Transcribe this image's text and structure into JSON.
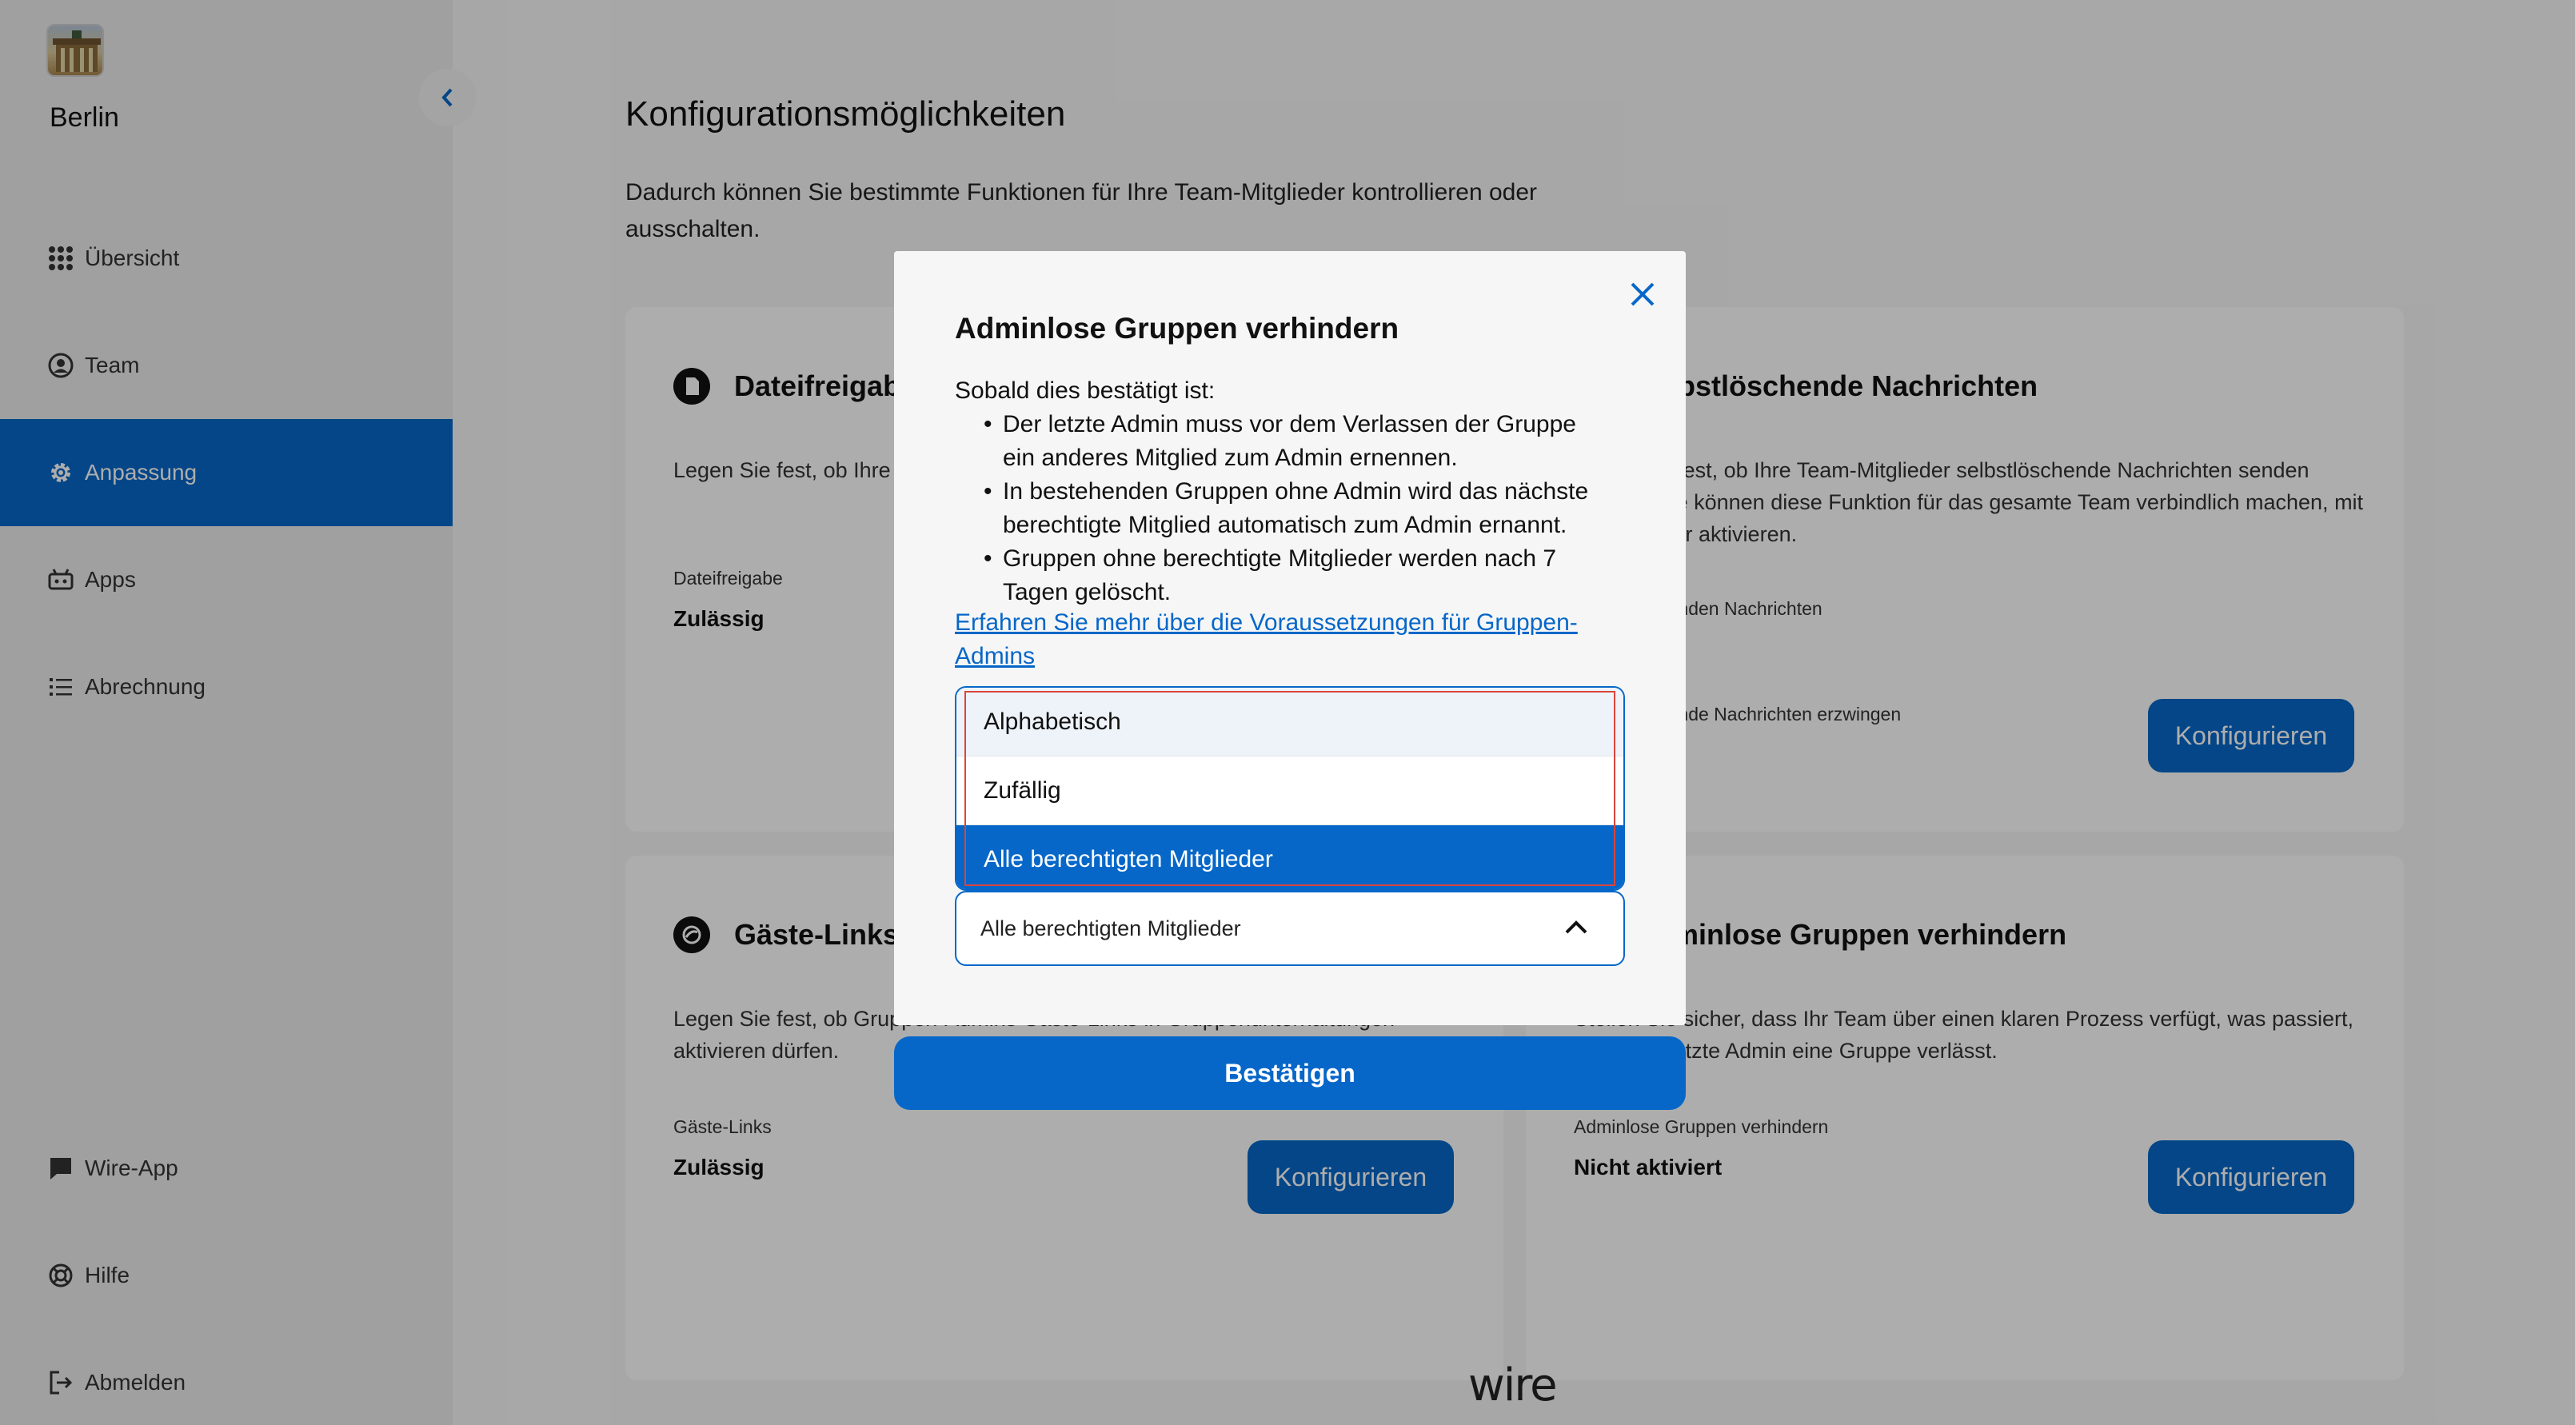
{
  "sidebar": {
    "team_name": "Berlin",
    "items": [
      {
        "label": "Übersicht",
        "icon": "grid-icon"
      },
      {
        "label": "Team",
        "icon": "user-circle-icon"
      },
      {
        "label": "Anpassung",
        "icon": "gear-icon",
        "active": true
      },
      {
        "label": "Apps",
        "icon": "apps-icon"
      },
      {
        "label": "Abrechnung",
        "icon": "list-icon"
      }
    ],
    "bottom_items": [
      {
        "label": "Wire-App",
        "icon": "chat-icon"
      },
      {
        "label": "Hilfe",
        "icon": "lifebuoy-icon"
      },
      {
        "label": "Abmelden",
        "icon": "logout-icon"
      }
    ]
  },
  "main": {
    "title": "Konfigurationsmöglichkeiten",
    "description": "Dadurch können Sie bestimmte Funktionen für Ihre Team-Mitglieder kontrollieren oder ausschalten.",
    "cards": [
      {
        "title": "Dateifreigabe",
        "description": "Legen Sie fest, ob Ihre Team-Mitglieder Dateien teilen können.",
        "label": "Dateifreigabe",
        "value": "Zulässig"
      },
      {
        "title": "Selbstlöschende Nachrichten",
        "description": "Legen Sie fest, ob Ihre Team-Mitglieder selbstlöschende Nachrichten senden können. Sie können diese Funktion für das gesamte Team verbindlich machen, mit einem Timer aktivieren.",
        "label": "Selbstlöschenden Nachrichten",
        "label2": "Selbstlöschende Nachrichten erzwingen",
        "button": "Konfigurieren"
      },
      {
        "title": "Gäste-Links",
        "description": "Legen Sie fest, ob Gruppen-Admins Gäste-Links in Gruppenunterhaltungen aktivieren dürfen.",
        "label": "Gäste-Links",
        "value": "Zulässig",
        "button": "Konfigurieren"
      },
      {
        "title": "Adminlose Gruppen verhindern",
        "description": "Stellen Sie sicher, dass Ihr Team über einen klaren Prozess verfügt, was passiert, wenn der letzte Admin eine Gruppe verlässt.",
        "label": "Adminlose Gruppen verhindern",
        "value": "Nicht aktiviert",
        "button": "Konfigurieren"
      }
    ],
    "footer_logo": "wire"
  },
  "modal": {
    "title": "Adminlose Gruppen verhindern",
    "intro": "Sobald dies bestätigt ist:",
    "bullets": [
      "Der letzte Admin muss vor dem Verlassen der Gruppe ein anderes Mitglied zum Admin ernennen.",
      "In bestehenden Gruppen ohne Admin wird das nächste berechtigte Mitglied automatisch zum Admin ernannt.",
      "Gruppen ohne berechtigte Mitglieder werden nach 7 Tagen gelöscht."
    ],
    "link": "Erfahren Sie mehr über die Voraussetzungen für Gruppen-Admins",
    "options": [
      "Alphabetisch",
      "Zufällig",
      "Alle berechtigten Mitglieder"
    ],
    "selected": "Alle berechtigten Mitglieder",
    "confirm": "Bestätigen"
  },
  "colors": {
    "accent": "#0667c8",
    "overlay": "rgba(0,0,0,0.32)"
  }
}
